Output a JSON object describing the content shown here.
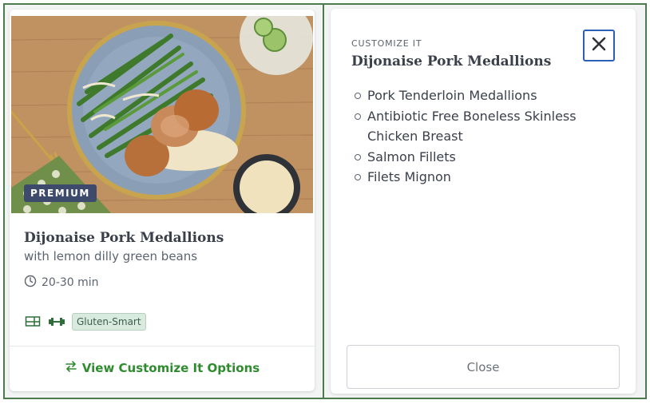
{
  "card": {
    "badge": "PREMIUM",
    "title": "Dijonaise Pork Medallions",
    "subtitle": "with lemon dilly green beans",
    "time": "20-30 min",
    "tags": {
      "icons": [
        "meal-tray-icon",
        "dumbbell-icon"
      ],
      "dietary_tag": "Gluten-Smart"
    },
    "view_options_label": "View Customize It Options"
  },
  "panel": {
    "eyebrow": "CUSTOMIZE IT",
    "title": "Dijonaise Pork Medallions",
    "options": [
      "Pork Tenderloin Medallions",
      "Antibiotic Free Boneless Skinless Chicken Breast",
      "Salmon Fillets",
      "Filets Mignon"
    ],
    "close_button_label": "Close"
  },
  "colors": {
    "accent_green": "#2e8b2e",
    "frame_green": "#4b7a4e",
    "close_blue": "#2b5fb3",
    "badge_navy": "#3d4a6b"
  }
}
